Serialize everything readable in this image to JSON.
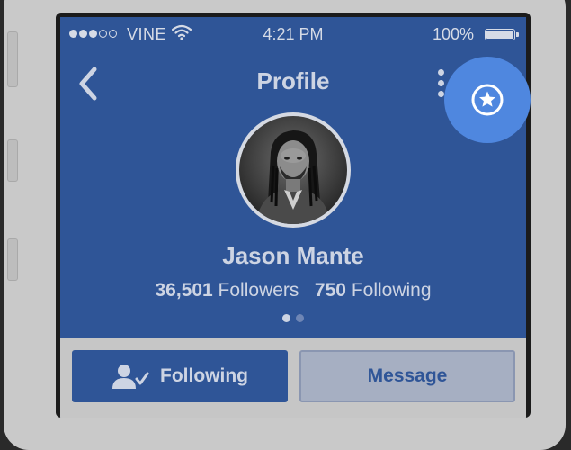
{
  "status_bar": {
    "signal_dots_filled": 3,
    "signal_dots_total": 5,
    "carrier": "VINE",
    "time": "4:21 PM",
    "battery": "100%"
  },
  "nav": {
    "title": "Profile",
    "back_icon": "chevron-left-icon",
    "more_icon": "vertical-ellipsis-icon",
    "star_icon": "star-circle-icon"
  },
  "profile": {
    "name": "Jason Mante",
    "followers_count": "36,501",
    "followers_label": "Followers",
    "following_count": "750",
    "following_label": "Following",
    "page_indicator": {
      "total": 2,
      "active": 1
    }
  },
  "actions": {
    "following_label": "Following",
    "message_label": "Message"
  },
  "colors": {
    "app_background": "#2f5597",
    "highlight": "#4f87df",
    "text_light": "#cdd4e3",
    "action_area": "#c6c6c6"
  }
}
